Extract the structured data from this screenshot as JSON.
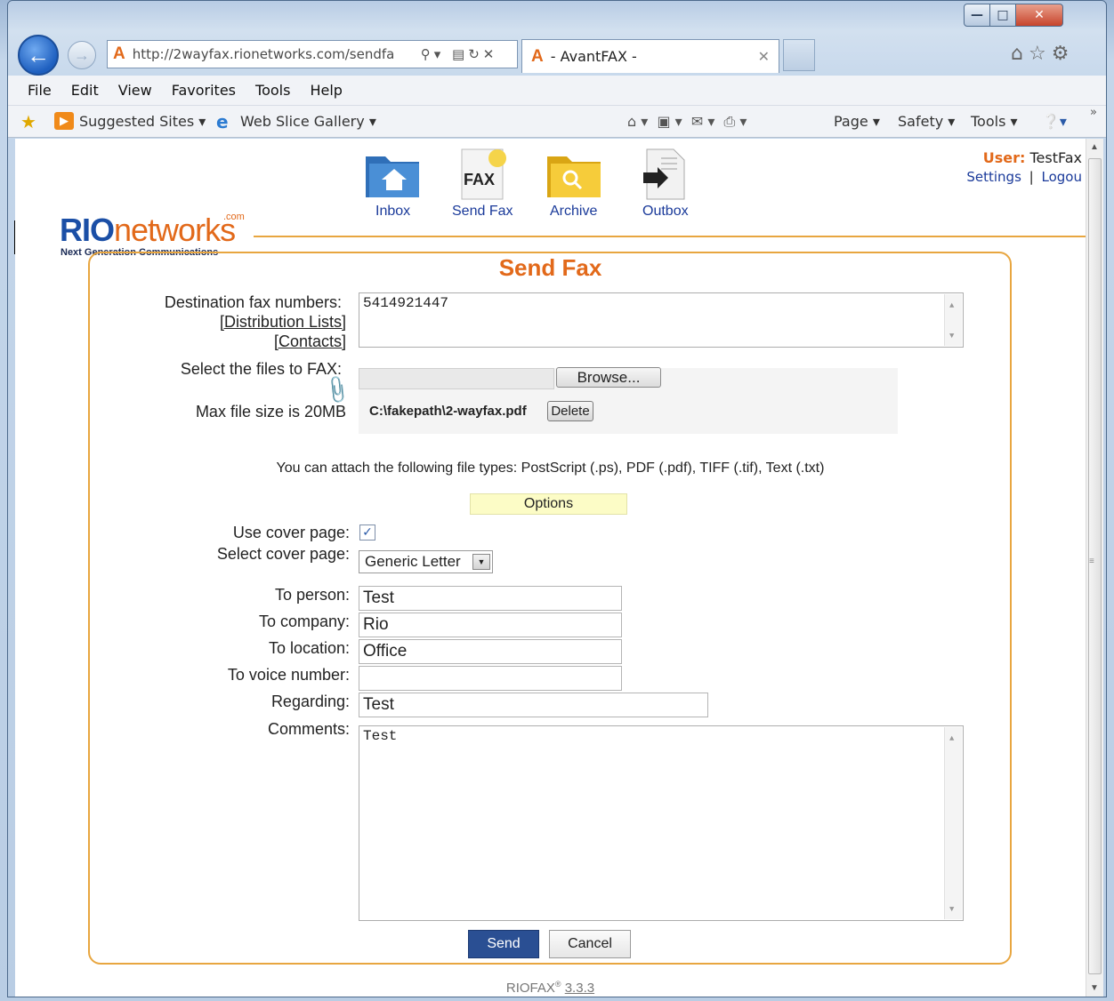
{
  "browser": {
    "url": "http://2wayfax.rionetworks.com/sendfa",
    "tab_title": "- AvantFAX -",
    "menu": [
      "File",
      "Edit",
      "View",
      "Favorites",
      "Tools",
      "Help"
    ],
    "favorites_bar": {
      "suggested_sites": "Suggested Sites",
      "web_slice_gallery": "Web Slice Gallery"
    },
    "command_bar": {
      "page": "Page",
      "safety": "Safety",
      "tools": "Tools"
    }
  },
  "header": {
    "nav": {
      "inbox": "Inbox",
      "send_fax": "Send Fax",
      "archive": "Archive",
      "outbox": "Outbox"
    },
    "fax_icon_text": "FAX",
    "user_label": "User:",
    "user_name": "TestFax",
    "settings": "Settings",
    "separator": "|",
    "logout": "Logou"
  },
  "logo": {
    "rio": "RIO",
    "networks": "networks",
    "com": ".com",
    "tagline": "Next Generation Communications"
  },
  "form": {
    "title": "Send Fax",
    "destination_label": "Destination fax numbers:",
    "distribution_lists": "[Distribution Lists]",
    "contacts": "[Contacts]",
    "destination_value": "5414921447",
    "select_files_label": "Select the files to FAX:",
    "browse": "Browse...",
    "max_size": "Max file size is 20MB",
    "attached_file": "C:\\fakepath\\2-wayfax.pdf",
    "delete": "Delete",
    "file_types": "You can attach the following file types: PostScript (.ps), PDF (.pdf), TIFF (.tif), Text (.txt)",
    "options": "Options",
    "use_cover_label": "Use cover page:",
    "use_cover_checked": true,
    "select_cover_label": "Select cover page:",
    "cover_selected": "Generic Letter",
    "to_person_label": "To person:",
    "to_person": "Test",
    "to_company_label": "To company:",
    "to_company": "Rio",
    "to_location_label": "To location:",
    "to_location": "Office",
    "to_voice_label": "To voice number:",
    "to_voice": "",
    "regarding_label": "Regarding:",
    "regarding": "Test",
    "comments_label": "Comments:",
    "comments": "Test",
    "send": "Send",
    "cancel": "Cancel"
  },
  "footer": {
    "product": "RIOFAX",
    "reg": "®",
    "version": "3.3.3"
  },
  "colors": {
    "accent_orange": "#e2691a",
    "rio_blue": "#1b4fa6",
    "panel_border": "#e8a640",
    "send_button": "#2a4f93",
    "options_bg": "#fcfcc6"
  }
}
